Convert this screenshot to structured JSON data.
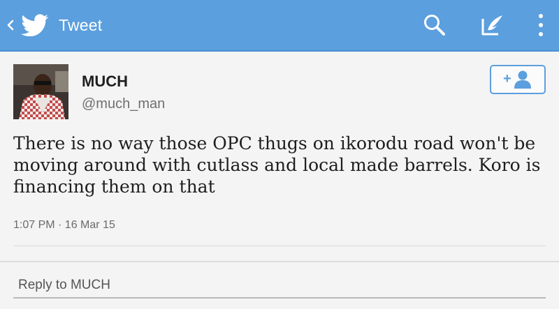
{
  "app_bar": {
    "title": "Tweet",
    "back_icon": "chevron-left-icon",
    "logo_icon": "twitter-bird-icon",
    "actions": [
      "search-icon",
      "compose-icon",
      "overflow-menu-icon"
    ],
    "color": "#5b9fde"
  },
  "tweet": {
    "author_name": "MUCH",
    "author_handle": "@much_man",
    "text": "There is no way those OPC thugs on ikorodu road won't be moving around with cutlass and local made barrels. Koro is financing them on that",
    "meta": "1:07 PM · 16 Mar 15",
    "follow_icon": "add-user-icon"
  },
  "reply": {
    "placeholder": "Reply to MUCH"
  }
}
